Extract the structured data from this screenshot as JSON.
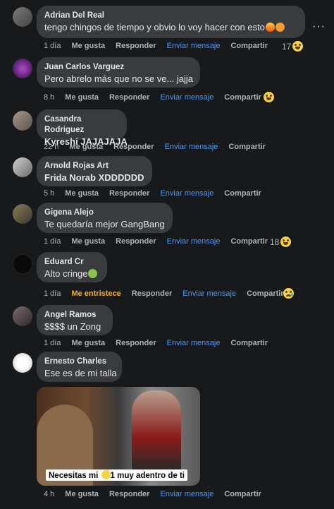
{
  "comments": [
    {
      "author": "Adrian Del Real",
      "text": "tengo chingos de tiempo y obvio lo voy hacer con esto",
      "time": "1 día",
      "reaction_label": "Me gusta",
      "reply": "Responder",
      "send": "Enviar mensaje",
      "share": "Compartir",
      "count": "17"
    },
    {
      "author": "Juan Carlos Varguez",
      "text": "Pero abrelo más que no se ve... jajja",
      "time": "8 h",
      "reaction_label": "Me gusta",
      "reply": "Responder",
      "send": "Enviar mensaje",
      "share": "Compartir",
      "count": ""
    },
    {
      "author": "Casandra Rodriguez",
      "text": "Kyreshi JAJAJAJA",
      "time": "22 h",
      "reaction_label": "Me gusta",
      "reply": "Responder",
      "send": "Enviar mensaje",
      "share": "Compartir",
      "count": ""
    },
    {
      "author": "Arnold Rojas Art",
      "text": "Frida Norab XDDDDDD",
      "time": "5 h",
      "reaction_label": "Me gusta",
      "reply": "Responder",
      "send": "Enviar mensaje",
      "share": "Compartir",
      "count": ""
    },
    {
      "author": "Gigena Alejo",
      "text": "Te quedaría mejor GangBang",
      "time": "1 día",
      "reaction_label": "Me gusta",
      "reply": "Responder",
      "send": "Enviar mensaje",
      "share": "Compartir",
      "count": "18"
    },
    {
      "author": "Eduard Cr",
      "text": "Alto cringe",
      "time": "1 día",
      "reaction_label": "Me entristece",
      "reply": "Responder",
      "send": "Enviar mensaje",
      "share": "Compartir",
      "count": ""
    },
    {
      "author": "Angel Ramos",
      "text": "$$$$ un Zong",
      "time": "1 día",
      "reaction_label": "Me gusta",
      "reply": "Responder",
      "send": "Enviar mensaje",
      "share": "Compartir",
      "count": ""
    },
    {
      "author": "Ernesto Charles",
      "text": "Ese es de mi talla",
      "time": "4 h",
      "reaction_label": "Me gusta",
      "reply": "Responder",
      "send": "Enviar mensaje",
      "share": "Compartir",
      "count": ""
    }
  ],
  "media": {
    "caption_before": "Necesitas mi",
    "caption_after": "1 muy adentro de ti"
  },
  "more_options": "···",
  "colors": {
    "background": "#18191a",
    "bubble": "#3a3b3c",
    "link": "#4599ff",
    "sad": "#f7b125"
  }
}
